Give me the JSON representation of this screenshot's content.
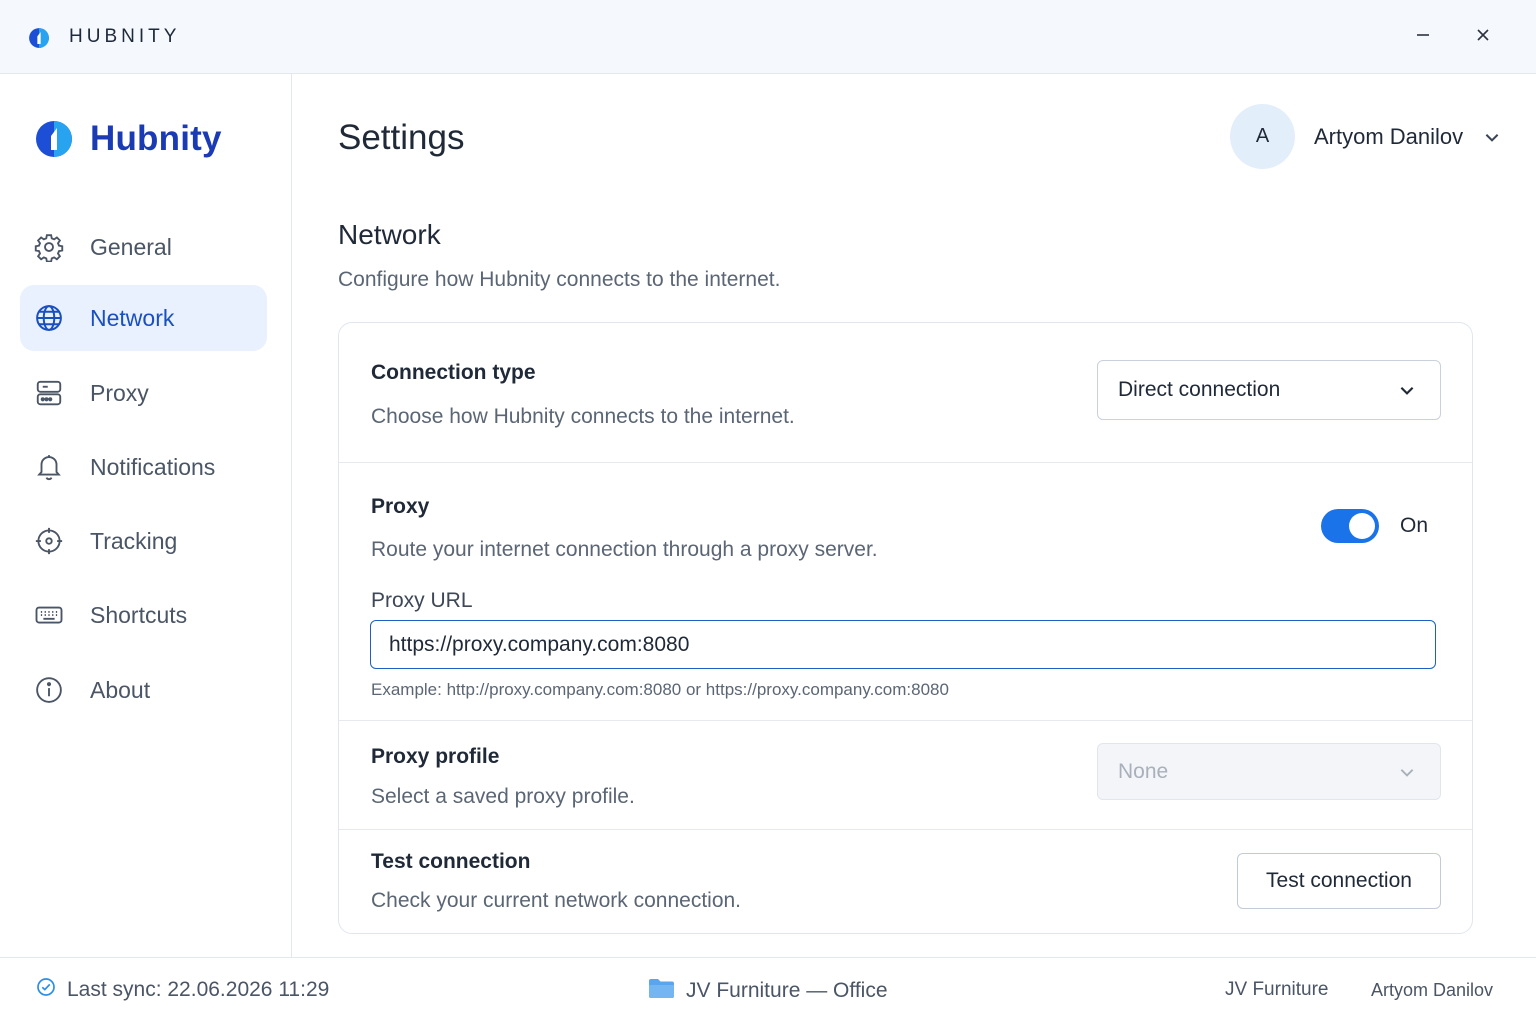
{
  "titlebar": {
    "app_name": "HUBNITY",
    "logo_icon": "hubnity-logo-icon",
    "minimize_icon": "minimize-icon",
    "close_icon": "close-icon"
  },
  "sidebar": {
    "brand": "Hubnity",
    "items": [
      {
        "label": "General",
        "icon": "gear-icon",
        "active": false
      },
      {
        "label": "Network",
        "icon": "globe-icon",
        "active": true
      },
      {
        "label": "Proxy",
        "icon": "server-icon",
        "active": false
      },
      {
        "label": "Notifications",
        "icon": "bell-icon",
        "active": false
      },
      {
        "label": "Tracking",
        "icon": "crosshair-icon",
        "active": false
      },
      {
        "label": "Shortcuts",
        "icon": "keyboard-icon",
        "active": false
      },
      {
        "label": "About",
        "icon": "info-icon",
        "active": false
      }
    ]
  },
  "header": {
    "title": "Settings",
    "user": {
      "initial": "A",
      "name": "Artyom Danilov"
    }
  },
  "section": {
    "title": "Network",
    "description": "Configure how Hubnity connects to the internet."
  },
  "connection_type": {
    "title": "Connection type",
    "description": "Choose how Hubnity connects to the internet.",
    "selected": "Direct connection"
  },
  "proxy": {
    "title": "Proxy",
    "description": "Route your internet connection through a proxy server.",
    "enabled": true,
    "toggle_label": "On",
    "url_label": "Proxy URL",
    "url_value": "https://proxy.company.com:8080",
    "helper": "Example: http://proxy.company.com:8080 or https://proxy.company.com:8080"
  },
  "proxy_profile": {
    "title": "Proxy profile",
    "description": "Select a saved proxy profile.",
    "selected": "None",
    "disabled": true
  },
  "test_connection": {
    "title": "Test connection",
    "description": "Check your current network connection.",
    "button_label": "Test connection"
  },
  "statusbar": {
    "sync": "Last sync: 22.06.2026 11:29",
    "workspace": "JV Furniture — Office",
    "organization": "JV Furniture",
    "user": "Artyom Danilov"
  },
  "colors": {
    "accent": "#1a73e8",
    "brand": "#1b3bb5",
    "active_nav_bg": "#e8f1fd",
    "sync_ok": "#2b8fe6",
    "folder": "#5aa6ee"
  }
}
